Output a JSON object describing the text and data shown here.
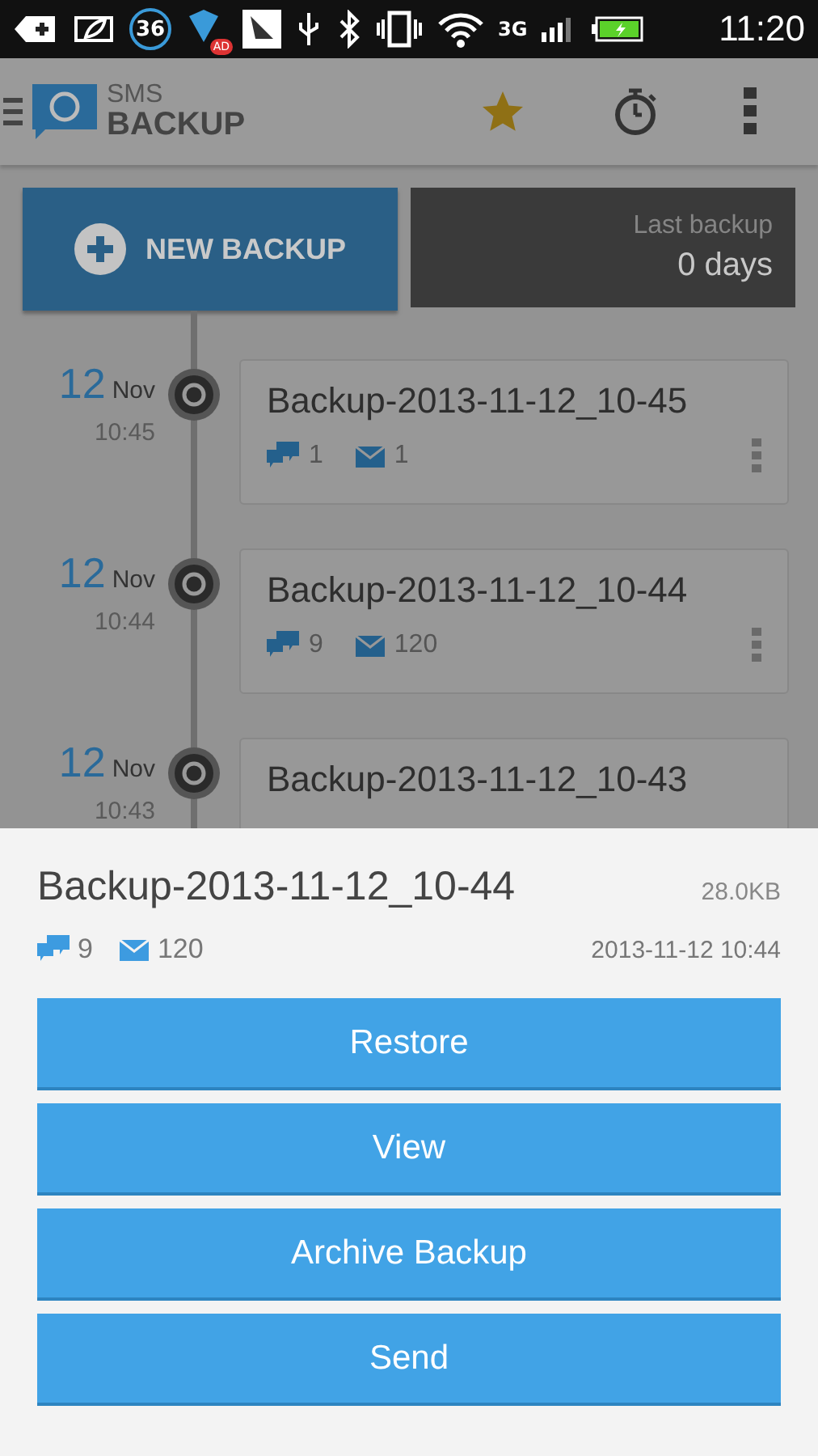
{
  "status_bar": {
    "badge_count": "36",
    "ad_label": "AD",
    "network": "3G",
    "time": "11:20"
  },
  "app_bar": {
    "logo_top": "SMS",
    "logo_bottom": "BACKUP"
  },
  "new_backup": {
    "label": "NEW BACKUP"
  },
  "last_backup": {
    "label": "Last backup",
    "value": "0 days"
  },
  "entries": [
    {
      "day": "12",
      "month": "Nov",
      "time": "10:45",
      "name": "Backup-2013-11-12_10-45",
      "sms": "1",
      "mms": "1"
    },
    {
      "day": "12",
      "month": "Nov",
      "time": "10:44",
      "name": "Backup-2013-11-12_10-44",
      "sms": "9",
      "mms": "120"
    },
    {
      "day": "12",
      "month": "Nov",
      "time": "10:43",
      "name": "Backup-2013-11-12_10-43"
    }
  ],
  "sheet": {
    "name": "Backup-2013-11-12_10-44",
    "size": "28.0KB",
    "sms": "9",
    "mms": "120",
    "date": "2013-11-12 10:44",
    "buttons": [
      "Restore",
      "View",
      "Archive Backup",
      "Send"
    ]
  }
}
